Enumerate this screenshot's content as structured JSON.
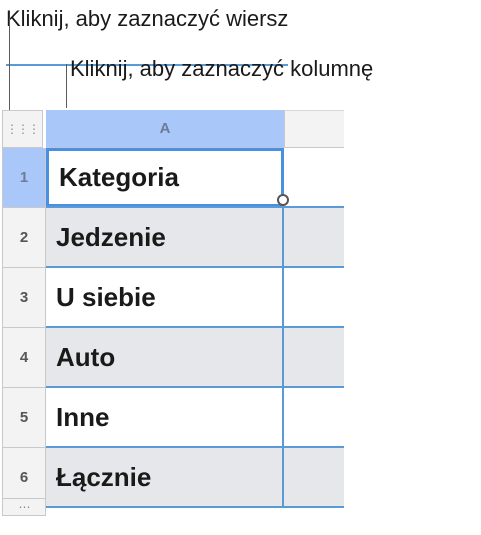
{
  "callouts": {
    "select_row": "Kliknij, aby zaznaczyć wiersz",
    "select_column": "Kliknij, aby zaznaczyć kolumnę"
  },
  "table": {
    "column_header": "A",
    "rows": [
      {
        "number": "1",
        "value": "Kategoria"
      },
      {
        "number": "2",
        "value": "Jedzenie"
      },
      {
        "number": "3",
        "value": "U siebie"
      },
      {
        "number": "4",
        "value": "Auto"
      },
      {
        "number": "5",
        "value": "Inne"
      },
      {
        "number": "6",
        "value": "Łącznie"
      }
    ]
  },
  "colors": {
    "selection_header": "#aac7f9",
    "grid_line": "#5b9bd5",
    "alt_row": "#e6e7ea"
  }
}
